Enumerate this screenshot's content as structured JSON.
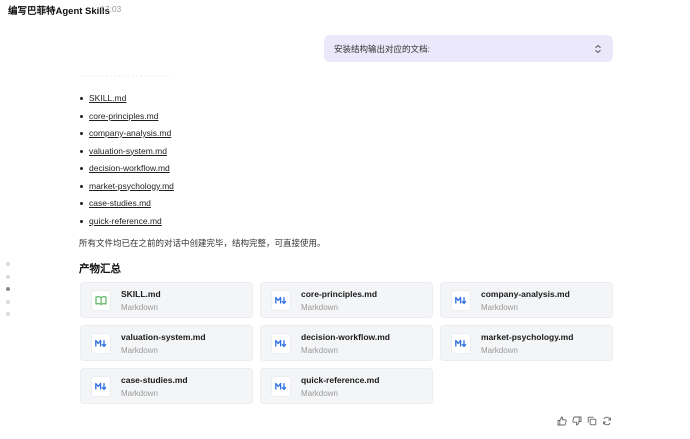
{
  "header": {
    "title": "编写巴菲特Agent Skills",
    "time": "17:03"
  },
  "prompt": {
    "text": "安装结构输出对应的文档:"
  },
  "faded_text": "· · · · · · · · · · · · · · · · · · · · · ·",
  "file_list": [
    "SKILL.md",
    "core-principles.md",
    "company-analysis.md",
    "valuation-system.md",
    "decision-workflow.md",
    "market-psychology.md",
    "case-studies.md",
    "quick-reference.md"
  ],
  "summary": "所有文件均已在之前的对话中创建完毕，结构完整，可直接使用。",
  "artifacts": {
    "heading": "产物汇总",
    "items": [
      {
        "name": "SKILL.md",
        "type": "Markdown",
        "icon": "book-icon",
        "color": "#4caf50"
      },
      {
        "name": "core-principles.md",
        "type": "Markdown",
        "icon": "markdown-icon",
        "color": "#2f6fe4"
      },
      {
        "name": "company-analysis.md",
        "type": "Markdown",
        "icon": "markdown-icon",
        "color": "#2f6fe4"
      },
      {
        "name": "valuation-system.md",
        "type": "Markdown",
        "icon": "markdown-icon",
        "color": "#2f6fe4"
      },
      {
        "name": "decision-workflow.md",
        "type": "Markdown",
        "icon": "markdown-icon",
        "color": "#2f6fe4"
      },
      {
        "name": "market-psychology.md",
        "type": "Markdown",
        "icon": "markdown-icon",
        "color": "#2f6fe4"
      },
      {
        "name": "case-studies.md",
        "type": "Markdown",
        "icon": "markdown-icon",
        "color": "#2f6fe4"
      },
      {
        "name": "quick-reference.md",
        "type": "Markdown",
        "icon": "markdown-icon",
        "color": "#2f6fe4"
      }
    ]
  },
  "actions": [
    "thumbs-up-icon",
    "thumbs-down-icon",
    "copy-icon",
    "refresh-icon"
  ],
  "scroll_indicator": {
    "count": 5,
    "active_index": 2
  }
}
